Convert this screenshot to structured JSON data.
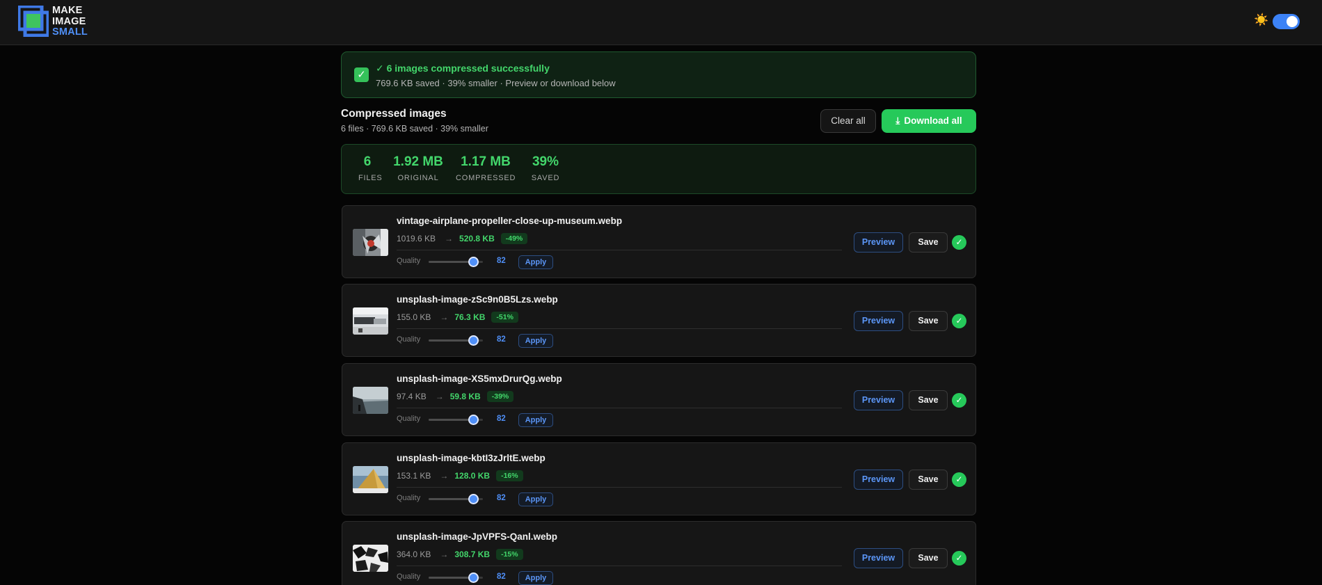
{
  "app": {
    "logo_line1": "MAKE",
    "logo_line2": "IMAGE",
    "logo_line3": "SMALL",
    "theme_icon": "sun-icon",
    "theme_toggle_on": true
  },
  "colors": {
    "accent_green": "#26c95a",
    "accent_blue": "#4f8ff7",
    "background": "#050505"
  },
  "banner": {
    "icon": "check-box-icon",
    "title": "✓ 6 images compressed successfully",
    "subtitle": "769.6 KB saved · 39% smaller · Preview or download below"
  },
  "section": {
    "title": "Compressed images",
    "subtitle": "6 files · 769.6 KB saved · 39% smaller",
    "clear_label": "Clear all",
    "download_label": "Download all",
    "download_icon": "download-icon"
  },
  "stats": [
    {
      "value": "6",
      "label": "FILES"
    },
    {
      "value": "1.92 MB",
      "label": "ORIGINAL"
    },
    {
      "value": "1.17 MB",
      "label": "COMPRESSED"
    },
    {
      "value": "39%",
      "label": "SAVED"
    }
  ],
  "files": [
    {
      "name": "vintage-airplane-propeller-close-up-museum.webp",
      "original": "1019.6 KB",
      "arrow": "→",
      "compressed": "520.8 KB",
      "reduction": "-49%",
      "quality_label": "Quality",
      "quality": "82",
      "quality_value": 82,
      "apply": "Apply",
      "preview": "Preview",
      "save": "Save",
      "status_icon": "check-circle-icon"
    },
    {
      "name": "unsplash-image-zSc9n0B5Lzs.webp",
      "original": "155.0 KB",
      "arrow": "→",
      "compressed": "76.3 KB",
      "reduction": "-51%",
      "quality_label": "Quality",
      "quality": "82",
      "quality_value": 82,
      "apply": "Apply",
      "preview": "Preview",
      "save": "Save",
      "status_icon": "check-circle-icon"
    },
    {
      "name": "unsplash-image-XS5mxDrurQg.webp",
      "original": "97.4 KB",
      "arrow": "→",
      "compressed": "59.8 KB",
      "reduction": "-39%",
      "quality_label": "Quality",
      "quality": "82",
      "quality_value": 82,
      "apply": "Apply",
      "preview": "Preview",
      "save": "Save",
      "status_icon": "check-circle-icon"
    },
    {
      "name": "unsplash-image-kbtI3zJrltE.webp",
      "original": "153.1 KB",
      "arrow": "→",
      "compressed": "128.0 KB",
      "reduction": "-16%",
      "quality_label": "Quality",
      "quality": "82",
      "quality_value": 82,
      "apply": "Apply",
      "preview": "Preview",
      "save": "Save",
      "status_icon": "check-circle-icon"
    },
    {
      "name": "unsplash-image-JpVPFS-Qanl.webp",
      "original": "364.0 KB",
      "arrow": "→",
      "compressed": "308.7 KB",
      "reduction": "-15%",
      "quality_label": "Quality",
      "quality": "82",
      "quality_value": 82,
      "apply": "Apply",
      "preview": "Preview",
      "save": "Save",
      "status_icon": "check-circle-icon"
    }
  ]
}
